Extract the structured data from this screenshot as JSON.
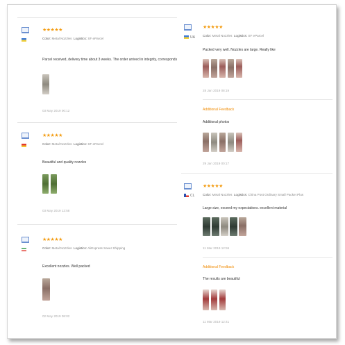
{
  "reviews_left": [
    {
      "country": "",
      "stars": "★★★★★",
      "color_label": "Color:",
      "color_value": "Metal Nozzles",
      "logistics_label": "Logistics:",
      "logistics_value": "SF eParcel",
      "text": "Parcel received, delivery time about 3 weeks. The order arrived in integrity, corresponds to the declared data. I recommen",
      "date": "03 May 2019 00:12"
    },
    {
      "country": "",
      "stars": "★★★★★",
      "color_label": "Color:",
      "color_value": "Metal Nozzles",
      "logistics_label": "Logistics:",
      "logistics_value": "SF eParcel",
      "text": "Beautiful and quality nozzles",
      "date": "03 May 2019 12:58"
    },
    {
      "country": "",
      "stars": "★★★★★",
      "color_label": "Color:",
      "color_value": "Metal Nozzles",
      "logistics_label": "Logistics:",
      "logistics_value": "AliExpress Saver Shipping",
      "text": "Excellent nozzles. Well packed",
      "date": "02 May 2019 08:02"
    }
  ],
  "reviews_right": [
    {
      "country": "UA",
      "stars": "★★★★★",
      "color_label": "Color:",
      "color_value": "Metal Nozzles",
      "logistics_label": "Logistics:",
      "logistics_value": "SF eParcel",
      "text": "Packed very well. Nozzles are large. Really like",
      "date": "28 Jan 2019 08:19",
      "additional_label": "Additional Feedback",
      "additional_text": "Additional photos",
      "additional_date": "29 Jan 2019 00:17"
    },
    {
      "country": "CL",
      "stars": "★★★★★",
      "color_label": "Color:",
      "color_value": "Metal Nozzles",
      "logistics_label": "Logistics:",
      "logistics_value": "China Post Ordinary Small Packet Plus",
      "text": "Large size, exceed my expectations. excellent material",
      "date": "11 Mar 2019 12:55",
      "additional_label": "Additional Feedback",
      "additional_text": "The results are beautiful",
      "additional_date": "11 Mar 2019 12:41"
    }
  ]
}
